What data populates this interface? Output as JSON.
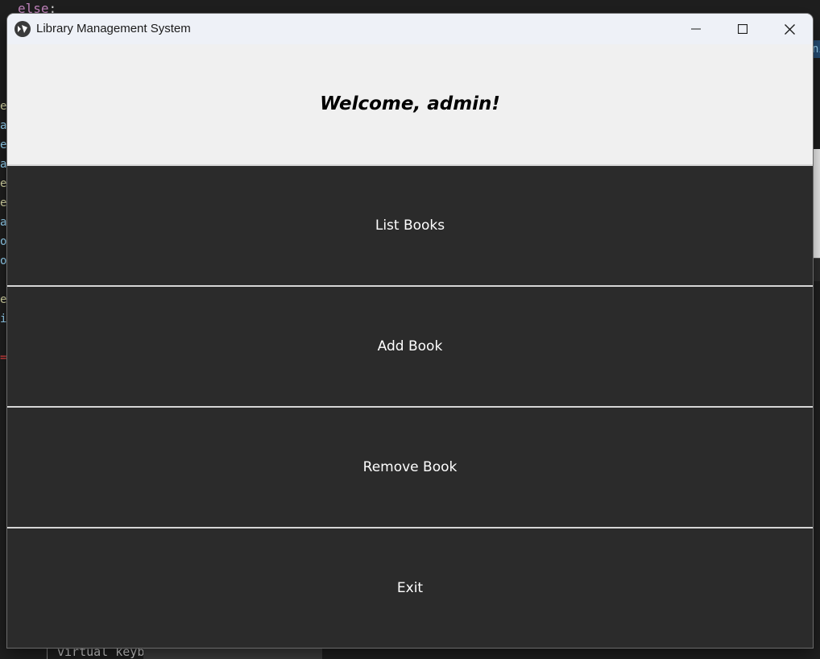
{
  "background_editor": {
    "code_keyword": "else",
    "code_punct": ":",
    "gutter_fragments": [
      "en",
      "ay",
      "el",
      "ay",
      "en",
      "en",
      "ay",
      "op",
      "op",
      "",
      "en",
      "it",
      "",
      "="
    ],
    "right_edge_fragment": "ni",
    "terminal_text": "virtual keyb"
  },
  "window": {
    "title": "Library Management System",
    "app_icon": "kivy-logo-icon",
    "controls": [
      "minimize-icon",
      "maximize-icon",
      "close-icon"
    ]
  },
  "welcome": {
    "text": "Welcome, admin!"
  },
  "menu": {
    "buttons": [
      {
        "label": "List Books"
      },
      {
        "label": "Add Book"
      },
      {
        "label": "Remove Book"
      },
      {
        "label": "Exit"
      }
    ]
  },
  "colors": {
    "button_bg": "#2b2b2b",
    "button_text": "#ffffff",
    "window_bg": "#f0f0f0",
    "titlebar_bg": "#eef1f7"
  }
}
